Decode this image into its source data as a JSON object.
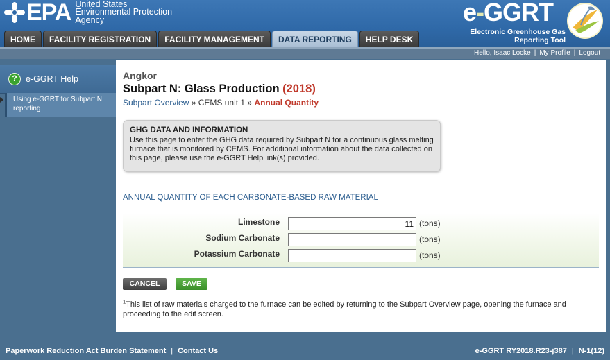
{
  "header": {
    "epa_word": "EPA",
    "epa_sub_lines": [
      "United States",
      "Environmental Protection",
      "Agency"
    ],
    "brand_word_prefix": "e",
    "brand_word_dash": "-",
    "brand_word_suffix": "GGRT",
    "brand_tag_lines": [
      "Electronic Greenhouse Gas",
      "Reporting Tool"
    ]
  },
  "nav": {
    "tabs": [
      {
        "label": "HOME",
        "active": false
      },
      {
        "label": "FACILITY REGISTRATION",
        "active": false
      },
      {
        "label": "FACILITY MANAGEMENT",
        "active": false
      },
      {
        "label": "DATA REPORTING",
        "active": true
      },
      {
        "label": "HELP DESK",
        "active": false
      }
    ]
  },
  "userbar": {
    "greeting": "Hello, Isaac Locke",
    "profile": "My Profile",
    "logout": "Logout"
  },
  "sidebar": {
    "help_label": "e-GGRT Help",
    "links": [
      "Using e-GGRT for Subpart N reporting"
    ]
  },
  "main": {
    "facility": "Angkor",
    "title": "Subpart N: Glass Production",
    "year": "(2018)",
    "breadcrumb": {
      "overview": "Subpart Overview",
      "sep1": " » ",
      "unit": "CEMS unit 1",
      "sep2": " » ",
      "current": "Annual Quantity"
    },
    "info": {
      "heading": "GHG DATA AND INFORMATION",
      "text": "Use this page to enter the GHG data required by Subpart N for a continuous glass melting furnace that is monitored by CEMS. For additional information about the data collected on this page, please use the e-GGRT Help link(s) provided."
    },
    "section_title": "ANNUAL QUANTITY OF EACH CARBONATE-BASED RAW MATERIAL",
    "rows": [
      {
        "label": "Limestone",
        "value": "11",
        "unit": "(tons)"
      },
      {
        "label": "Sodium Carbonate",
        "value": "",
        "unit": "(tons)"
      },
      {
        "label": "Potassium Carbonate",
        "value": "",
        "unit": "(tons)"
      }
    ],
    "cancel_label": "CANCEL",
    "save_label": "SAVE",
    "footnote_mark": "1",
    "footnote": "This list of raw materials charged to the furnace can be edited by returning to the Subpart Overview page, opening the furnace and proceeding to the edit screen."
  },
  "footer": {
    "paperwork": "Paperwork Reduction Act Burden Statement",
    "contact": "Contact Us",
    "version": "e-GGRT RY2018.R23-j387",
    "page_code": "N-1(12)"
  },
  "colors": {
    "header_blue": "#2f69a8",
    "accent_red": "#c0392b",
    "link_blue": "#2b5d8f",
    "save_green": "#3a8f2a"
  }
}
